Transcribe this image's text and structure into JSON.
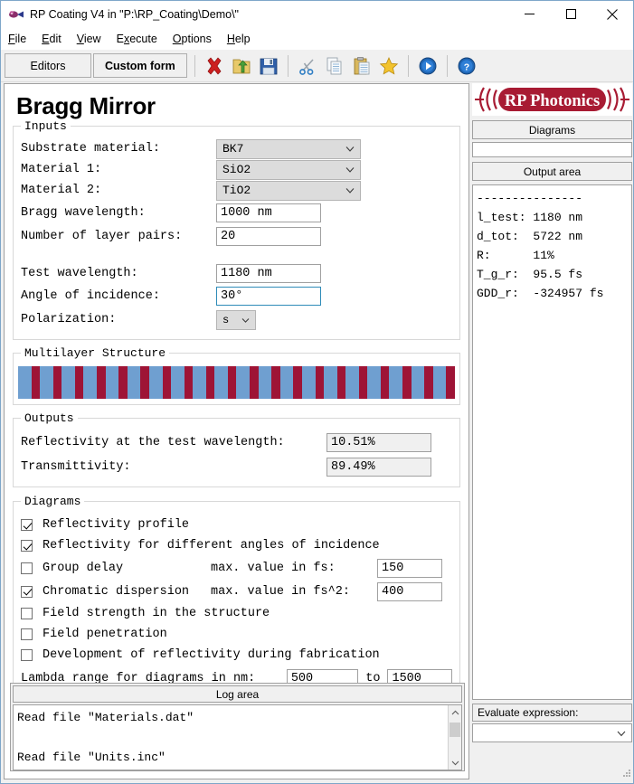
{
  "window": {
    "title": "RP Coating V4 in \"P:\\RP_Coating\\Demo\\\"",
    "icon": "app-icon",
    "minimize": "minimize-icon",
    "maximize": "maximize-icon",
    "close": "close-icon"
  },
  "menu": {
    "items": [
      {
        "accel": "F",
        "rest": "ile"
      },
      {
        "accel": "E",
        "rest": "dit"
      },
      {
        "accel": "V",
        "rest": "iew"
      },
      {
        "pre": "E",
        "accel": "x",
        "rest": "ecute"
      },
      {
        "accel": "O",
        "rest": "ptions"
      },
      {
        "accel": "H",
        "rest": "elp"
      }
    ]
  },
  "toolbar": {
    "editors_label": "Editors",
    "custom_form_label": "Custom form",
    "icons": [
      "delete-icon",
      "open-folder-icon",
      "save-icon",
      "cut-icon",
      "copy-icon",
      "paste-icon",
      "favorite-star-icon",
      "run-icon",
      "help-icon"
    ]
  },
  "main": {
    "page_title": "Bragg Mirror",
    "inputs": {
      "title": "Inputs",
      "fields": [
        {
          "label": "Substrate material:",
          "value": "BK7",
          "type": "combo"
        },
        {
          "label": "Material 1:",
          "value": "SiO2",
          "type": "combo"
        },
        {
          "label": "Material 2:",
          "value": "TiO2",
          "type": "combo"
        },
        {
          "label": "Bragg wavelength:",
          "value": "1000 nm",
          "type": "text"
        },
        {
          "label": "Number of layer pairs:",
          "value": "20",
          "type": "text"
        }
      ],
      "fields2": [
        {
          "label": "Test wavelength:",
          "value": "1180 nm",
          "type": "text"
        },
        {
          "label": "Angle of incidence:",
          "value": "30°",
          "type": "text",
          "focused": true
        },
        {
          "label": "Polarization:",
          "value": "s",
          "type": "combo-small"
        }
      ]
    },
    "multilayer": {
      "title": "Multilayer Structure",
      "pairs": 20,
      "color_low": "#6f9fd0",
      "color_high": "#9e1436"
    },
    "outputs": {
      "title": "Outputs",
      "rows": [
        {
          "label": "Reflectivity at the test wavelength:",
          "value": "10.51%"
        },
        {
          "label": "Transmittivity:",
          "value": "89.49%"
        }
      ]
    },
    "diagrams": {
      "title": "Diagrams",
      "checkboxes": [
        {
          "label": "Reflectivity profile",
          "checked": true
        },
        {
          "label": "Reflectivity for different angles of incidence",
          "checked": true
        },
        {
          "label": "Group delay",
          "checked": false,
          "extra_label": "max. value in fs:",
          "extra_value": "150"
        },
        {
          "label": "Chromatic dispersion",
          "checked": true,
          "extra_label": "max. value in fs^2:",
          "extra_value": "400"
        },
        {
          "label": "Field strength in the structure",
          "checked": false
        },
        {
          "label": "Field penetration",
          "checked": false
        },
        {
          "label": "Development of reflectivity during fabrication",
          "checked": false
        }
      ],
      "lambda_label": "Lambda range for diagrams in nm:",
      "lambda_from": "500",
      "lambda_to_label": "to",
      "lambda_to": "1500"
    }
  },
  "log": {
    "header": "Log area",
    "lines": [
      "Read file \"Materials.dat\"",
      "",
      "Read file \"Units.inc\""
    ]
  },
  "sidebar": {
    "logo_text": "RP Photonics",
    "logo_color": "#a81b33",
    "diagrams_button": "Diagrams",
    "output_area_button": "Output area",
    "output_lines": [
      "---------------",
      "l_test: 1180 nm",
      "d_tot:  5722 nm",
      "R:      11%",
      "T_g_r:  95.5 fs",
      "GDD_r:  -324957 fs"
    ],
    "evaluate_label": "Evaluate expression:",
    "evaluate_value": ""
  }
}
